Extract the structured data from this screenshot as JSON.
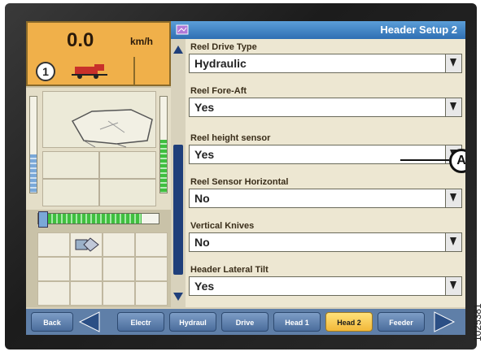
{
  "status": {
    "speed_value": "0.0",
    "speed_unit": "km/h",
    "gear": "1"
  },
  "header": {
    "title": "Header Setup 2"
  },
  "settings": [
    {
      "label": "Reel Drive Type",
      "value": "Hydraulic"
    },
    {
      "label": "Reel Fore-Aft",
      "value": "Yes"
    },
    {
      "label": "Reel height sensor",
      "value": "Yes"
    },
    {
      "label": "Reel Sensor Horizontal",
      "value": "No"
    },
    {
      "label": "Vertical Knives",
      "value": "No"
    },
    {
      "label": "Header Lateral Tilt",
      "value": "Yes"
    }
  ],
  "callout": {
    "label": "A"
  },
  "nav": {
    "back": "Back",
    "tabs": [
      "Electr",
      "Hydraul",
      "Drive",
      "Head 1",
      "Head 2",
      "Feeder"
    ],
    "active_tab": "Head 2"
  },
  "figure_id": "1025381",
  "icons": {
    "scroll_up": "up-arrow-icon",
    "scroll_down": "down-arrow-icon",
    "dropdown": "chevron-down-icon",
    "nav_prev": "left-arrow-icon",
    "nav_next": "right-arrow-icon"
  },
  "colors": {
    "title_bar": "#2f6fb3",
    "speed_panel": "#f0b04a",
    "nav_bar": "#5f7fa8",
    "active_tab": "#f2b83a",
    "scroll_thumb": "#1f3f7a"
  }
}
